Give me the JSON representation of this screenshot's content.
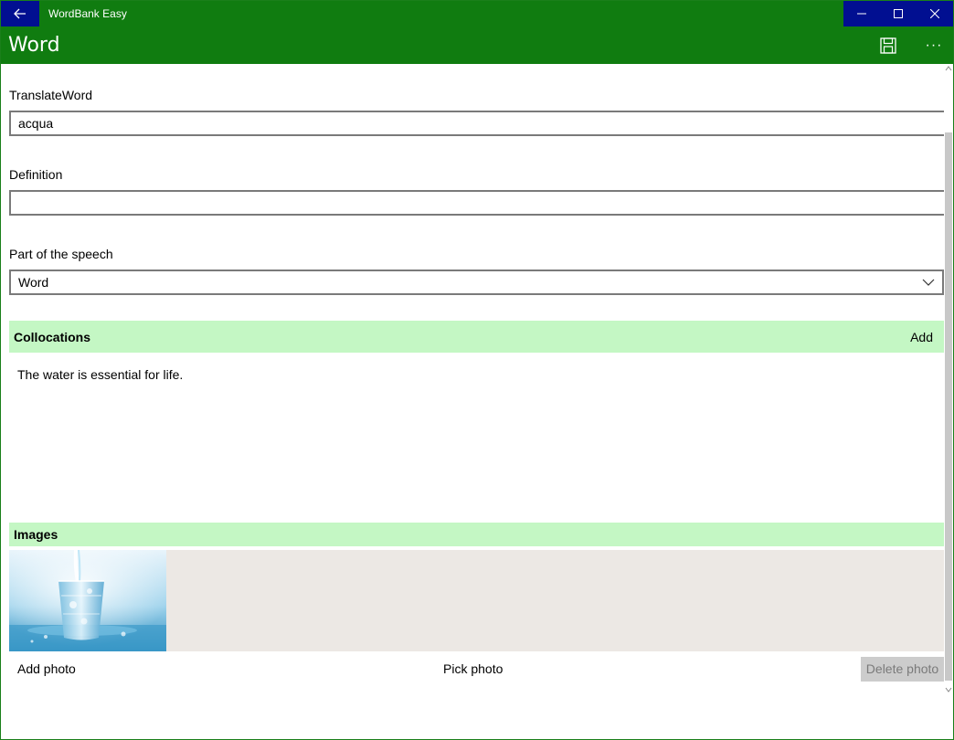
{
  "window": {
    "app_title": "WordBank Easy"
  },
  "header": {
    "page_title": "Word",
    "more_label": "···"
  },
  "form": {
    "translate_label": "TranslateWord",
    "translate_value": "acqua",
    "definition_label": "Definition",
    "definition_value": "",
    "part_label": "Part of the speech",
    "part_value": "Word"
  },
  "collocations": {
    "title": "Collocations",
    "add_label": "Add",
    "items": [
      "The water is essential for life."
    ]
  },
  "images": {
    "title": "Images",
    "photo_icon": "water-glass-photo"
  },
  "actions": {
    "add_photo": "Add photo",
    "pick_photo": "Pick photo",
    "delete_photo": "Delete photo"
  },
  "colors": {
    "title_green": "#107c10",
    "caption_blue": "#010f91",
    "section_bg": "#c4f7c4",
    "images_bg": "#ece8e4"
  }
}
